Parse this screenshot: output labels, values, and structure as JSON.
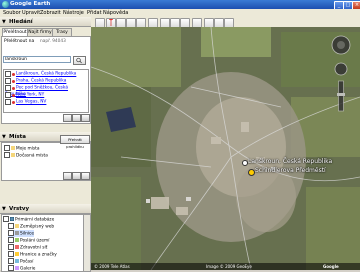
{
  "window": {
    "title": "Google Earth"
  },
  "menu": [
    "Soubor",
    "Upravit",
    "Zobrazit",
    "Nástroje",
    "Přidat",
    "Nápověda"
  ],
  "search": {
    "header": "Hledání",
    "tabs": [
      "Přelétnout",
      "Najít firmy",
      "Trasy"
    ],
    "fly_label": "Přelétnout na",
    "fly_hint": "např. 94043",
    "input_value": "lanskroun",
    "results": [
      "Lanškroun, Česká Republika",
      "Praha, Česká Republika",
      "Pec pod Sněžkou, Česká Republika",
      "New York, NY",
      "Las Vegas, NV"
    ]
  },
  "places": {
    "header": "Místa",
    "tour_button": "Přehrát prohlídku",
    "items": [
      "Moje místa",
      "Dočasná místa"
    ]
  },
  "layers": {
    "header": "Vrstvy",
    "items": [
      "Primární databáze",
      "Zeměpisný web",
      "Silnice",
      "Posláni území",
      "Zdravotní síť",
      "Hranice a značky",
      "Počasí",
      "Galerie"
    ]
  },
  "map": {
    "labels": [
      "Lanškroun, Česká Republika",
      "Schindlerova Předměstí"
    ],
    "status": {
      "left": "© 2009 Tele Atlas",
      "center": "Image © 2009 GeoEye",
      "right": "Google"
    }
  }
}
